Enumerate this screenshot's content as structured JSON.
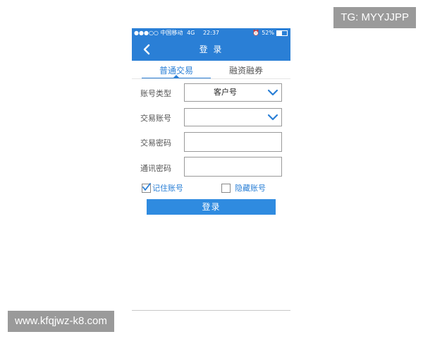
{
  "watermarks": {
    "top_right": "TG: MYYJJPP",
    "bottom_left": "www.kfqjwz-k8.com"
  },
  "statusbar": {
    "carrier": "●●●○○ 中国移动",
    "network": "4G",
    "time": "22:37",
    "battery": "52%",
    "battery_level": 0.52
  },
  "navbar": {
    "back_icon": "chevron-left-icon",
    "title": "登 录"
  },
  "tabs": [
    {
      "label": "普通交易",
      "active": true
    },
    {
      "label": "融资融券",
      "active": false
    }
  ],
  "form": {
    "account_type": {
      "label": "账号类型",
      "value": "客户号"
    },
    "trade_account": {
      "label": "交易账号",
      "value": ""
    },
    "trade_password": {
      "label": "交易密码",
      "value": ""
    },
    "comm_password": {
      "label": "通讯密码",
      "value": ""
    }
  },
  "options": {
    "remember": {
      "label": "记住账号",
      "checked": true
    },
    "hide": {
      "label": "隐藏账号",
      "checked": false
    }
  },
  "login_button": "登录",
  "colors": {
    "primary": "#2a7fd6",
    "button": "#2f8be0"
  }
}
